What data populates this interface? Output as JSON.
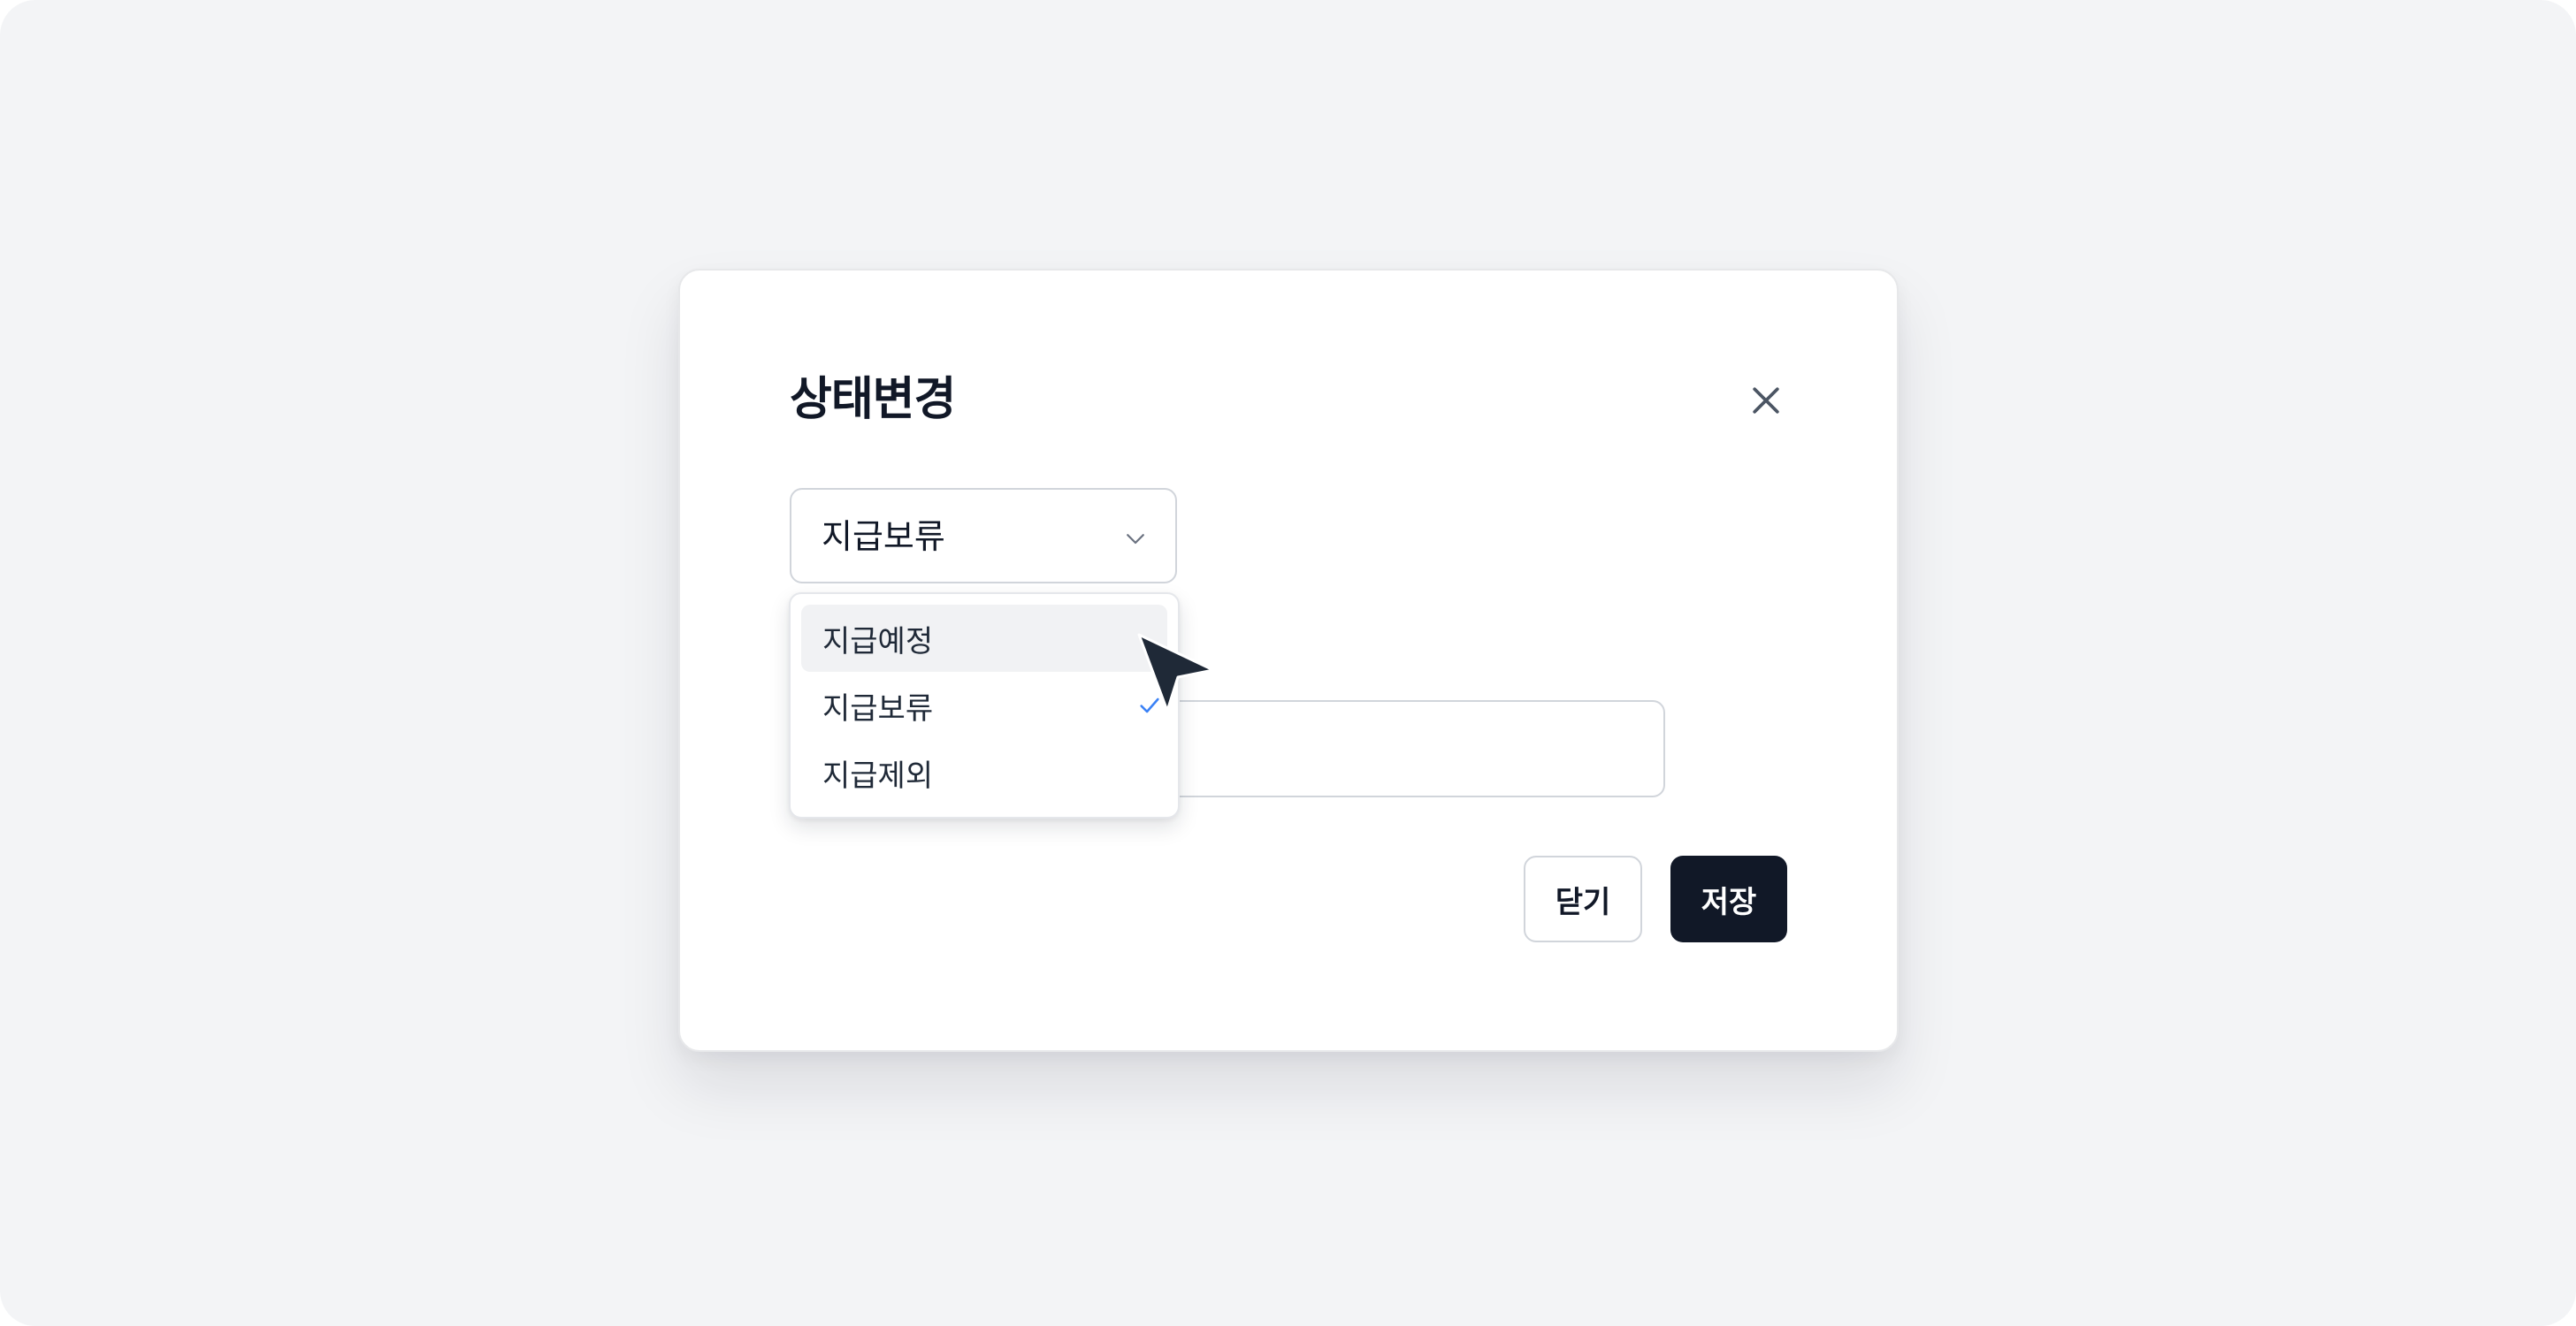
{
  "modal": {
    "title": "상태변경",
    "close_icon": "close-icon"
  },
  "status_select": {
    "value": "지급보류",
    "chevron_icon": "chevron-down-icon"
  },
  "dropdown": {
    "options": [
      {
        "label": "지급예정",
        "highlighted": true,
        "selected": false
      },
      {
        "label": "지급보류",
        "highlighted": false,
        "selected": true
      },
      {
        "label": "지급제외",
        "highlighted": false,
        "selected": false
      }
    ],
    "check_icon": "check-icon",
    "check_color": "#3b82f6"
  },
  "memo_field": {
    "value": ""
  },
  "buttons": {
    "close_label": "닫기",
    "save_label": "저장"
  },
  "colors": {
    "background": "#f3f4f6",
    "primary": "#111827",
    "highlight": "#f1f2f4"
  }
}
